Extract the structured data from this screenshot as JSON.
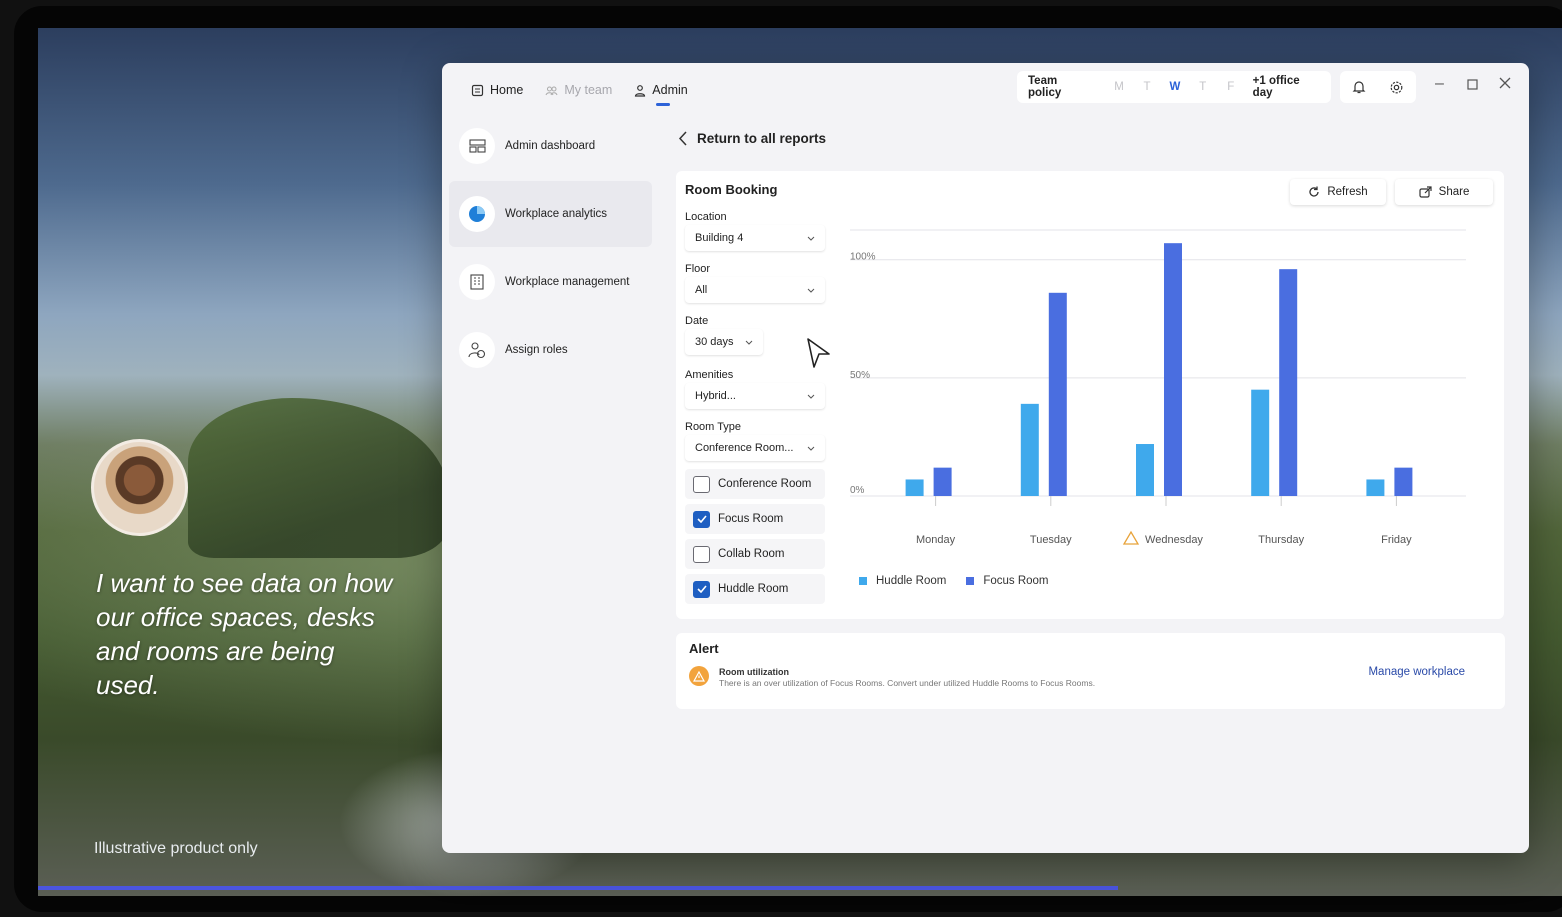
{
  "overlay": {
    "quote": "I want to see data on how our office spaces, desks and rooms are being used.",
    "disclaimer": "Illustrative product only"
  },
  "topnav": [
    {
      "label": "Home",
      "icon": "home-icon"
    },
    {
      "label": "My team",
      "icon": "team-icon"
    },
    {
      "label": "Admin",
      "icon": "person-icon"
    }
  ],
  "policy": {
    "label": "Team policy",
    "days": [
      "M",
      "T",
      "W",
      "T",
      "F"
    ],
    "active_day": "W",
    "extra": "+1 office day"
  },
  "sidebar": [
    {
      "label": "Admin dashboard",
      "icon": "dashboard-icon"
    },
    {
      "label": "Workplace analytics",
      "icon": "pie-chart-icon",
      "active": true
    },
    {
      "label": "Workplace management",
      "icon": "building-icon"
    },
    {
      "label": "Assign roles",
      "icon": "assign-roles-icon"
    }
  ],
  "back_label": "Return to all reports",
  "report": {
    "title": "Room Booking",
    "refresh_label": "Refresh",
    "share_label": "Share",
    "filters": {
      "location_label": "Location",
      "location_value": "Building 4",
      "floor_label": "Floor",
      "floor_value": "All",
      "date_label": "Date",
      "date_value": "30 days",
      "amenities_label": "Amenities",
      "amenities_value": "Hybrid...",
      "roomtype_label": "Room Type",
      "roomtype_value": "Conference Room..."
    },
    "room_types": [
      {
        "label": "Conference Room",
        "checked": false
      },
      {
        "label": "Focus Room",
        "checked": true
      },
      {
        "label": "Collab Room",
        "checked": false
      },
      {
        "label": "Huddle Room",
        "checked": true
      }
    ]
  },
  "chart_data": {
    "type": "bar",
    "categories": [
      "Monday",
      "Tuesday",
      "Wednesday",
      "Thursday",
      "Friday"
    ],
    "warning_category": "Wednesday",
    "series": [
      {
        "name": "Huddle Room",
        "color": "#3fa9ec",
        "values": [
          7,
          39,
          22,
          45,
          7
        ]
      },
      {
        "name": "Focus Room",
        "color": "#4a6ee0",
        "values": [
          12,
          86,
          107,
          96,
          12
        ]
      }
    ],
    "yticks": [
      "0%",
      "50%",
      "100%"
    ],
    "ylim": [
      0,
      113
    ],
    "grid": true,
    "legend": "bottom-left"
  },
  "alert": {
    "title": "Alert",
    "item_title": "Room utilization",
    "item_desc": "There is an over utilization of Focus Rooms. Convert under utilized Huddle Rooms to Focus Rooms.",
    "link": "Manage workplace"
  }
}
